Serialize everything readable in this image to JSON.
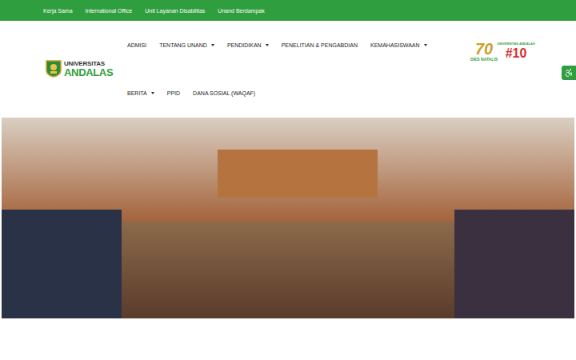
{
  "top_bar": {
    "links": [
      "Kerja Sama",
      "International Office",
      "Unit Layanan Disabilitas",
      "Unand Berdampak"
    ]
  },
  "logo": {
    "line1": "UNIVERSITAS",
    "line2": "ANDALAS"
  },
  "nav": {
    "rows": [
      [
        {
          "label": "ADMISI",
          "has_dropdown": false
        },
        {
          "label": "TENTANG UNAND",
          "has_dropdown": true
        },
        {
          "label": "PENDIDIKAN",
          "has_dropdown": true
        },
        {
          "label": "PENELITIAN & PENGABDIAN",
          "has_dropdown": false
        },
        {
          "label": "KEMAHASISWAAN",
          "has_dropdown": true
        }
      ],
      [
        {
          "label": "BERITA",
          "has_dropdown": true
        },
        {
          "label": "PPID",
          "has_dropdown": false
        },
        {
          "label": "DANA SOSIAL (WAQAF)",
          "has_dropdown": false
        }
      ]
    ]
  },
  "badges": {
    "anniversary": {
      "number": "70",
      "caption": "DIES NATALIS"
    },
    "rank": {
      "org": "UNIVERSITAS ANDALAS",
      "number": "#10"
    }
  }
}
